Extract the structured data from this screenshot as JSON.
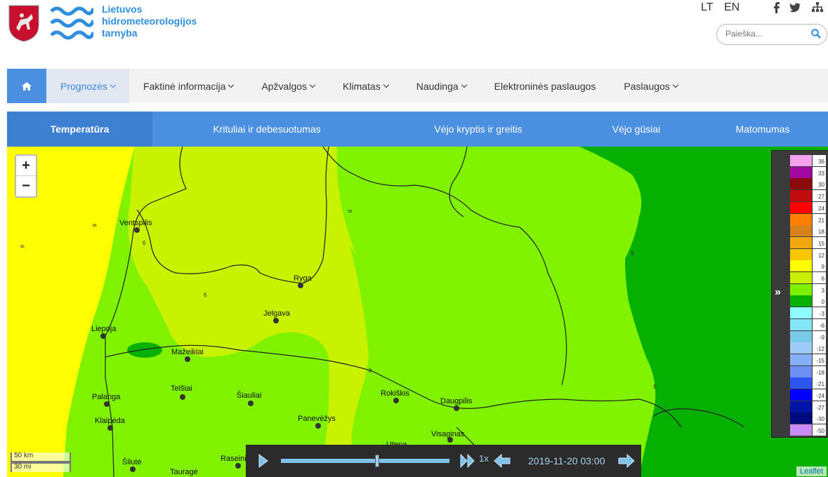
{
  "header": {
    "logo_line1": "Lietuvos",
    "logo_line2": "hidrometeorologijos",
    "logo_line3": "tarnyba",
    "lang_lt": "LT",
    "lang_en": "EN",
    "search_placeholder": "Paieška..."
  },
  "nav": {
    "items": [
      {
        "label": "Prognozės"
      },
      {
        "label": "Faktinė informacija"
      },
      {
        "label": "Apžvalgos"
      },
      {
        "label": "Klimatas"
      },
      {
        "label": "Naudinga"
      },
      {
        "label": "Elektroninės paslaugos"
      },
      {
        "label": "Paslaugos"
      }
    ]
  },
  "subtabs": [
    {
      "label": "Temperatūra"
    },
    {
      "label": "Krituliai ir debesuotumas"
    },
    {
      "label": "Vėjo kryptis ir greitis"
    },
    {
      "label": "Vėjo gūsiai"
    },
    {
      "label": "Matomumas"
    }
  ],
  "map": {
    "zoom_in": "+",
    "zoom_out": "−",
    "scale_km": "50 km",
    "scale_mi": "30 mi",
    "attribution": "Leaflet",
    "cities": [
      "Ventspilis",
      "Ryga",
      "Jelgava",
      "Liepoja",
      "Mažeikiai",
      "Telšiai",
      "Šiauliai",
      "Palanga",
      "Klaipėda",
      "Rokiškis",
      "Daugpilis",
      "Panevėžys",
      "Visaginas",
      "Utena",
      "Šilutė",
      "Tauragė",
      "Raseiniai"
    ],
    "isoline_label": "6",
    "isoline_label_9": "9"
  },
  "legend": {
    "labels": [
      "36",
      "33",
      "30",
      "27",
      "24",
      "21",
      "18",
      "15",
      "12",
      "9",
      "6",
      "3",
      "0",
      "-3",
      "-6",
      "-9",
      "-12",
      "-15",
      "-18",
      "-21",
      "-24",
      "-27",
      "-30",
      "-50"
    ],
    "colors": [
      "#f7a1ef",
      "#a0089e",
      "#8b0b0b",
      "#c00d0d",
      "#ff0000",
      "#ff7f00",
      "#d8801a",
      "#f1a70f",
      "#f7c600",
      "#ffff00",
      "#c6f000",
      "#7ff000",
      "#06b000",
      "#8ffbfb",
      "#86e6f7",
      "#79c8e8",
      "#9fcaf7",
      "#86b1f7",
      "#6d8ff2",
      "#2d56f0",
      "#0000ff",
      "#0015a8",
      "#000a7d",
      "#c78cf7"
    ]
  },
  "player": {
    "speed": "1x",
    "timestamp": "2019-11-20 03:00",
    "progress": 0.57
  },
  "colors": {
    "accent": "#4a8fe0",
    "logo_blue": "#2f8ee0"
  }
}
